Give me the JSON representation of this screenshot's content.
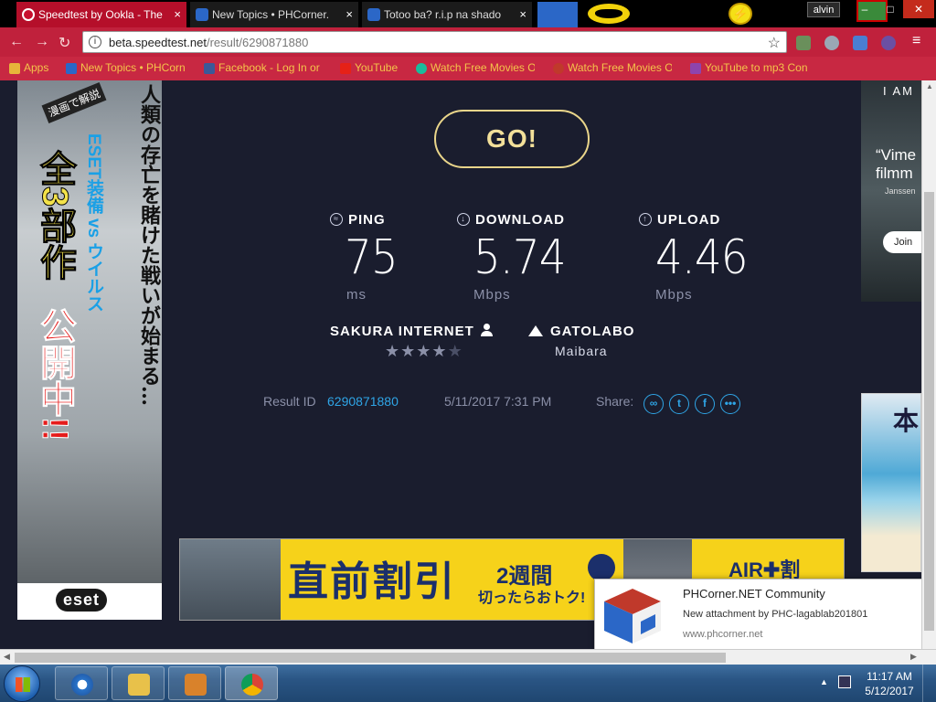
{
  "browser": {
    "tabs": [
      {
        "title": "Speedtest by Ookla - The",
        "active": true
      },
      {
        "title": "New Topics • PHCorner.",
        "active": false
      },
      {
        "title": "Totoo ba? r.i.p na shado",
        "active": false
      }
    ],
    "tab_close": "×",
    "user_name": "alvin",
    "window_buttons": {
      "minimize": "–",
      "maximize": "□",
      "close": "✕"
    },
    "url_host": "beta.speedtest.net",
    "url_path": "/result/6290871880",
    "star_glyph": "☆",
    "info_glyph": "i",
    "nav": {
      "back": "←",
      "forward": "→",
      "reload": "↻"
    },
    "bookmarks": [
      {
        "label": "Apps"
      },
      {
        "label": "New Topics • PHCorn"
      },
      {
        "label": "Facebook - Log In or"
      },
      {
        "label": "YouTube"
      },
      {
        "label": "Watch Free Movies On"
      },
      {
        "label": "Watch Free Movies Or"
      },
      {
        "label": "YouTube to mp3 Con"
      }
    ]
  },
  "speedtest": {
    "go_label": "GO!",
    "ping": {
      "label": "PING",
      "value": "75",
      "unit": "ms"
    },
    "download": {
      "label": "DOWNLOAD",
      "value": "5.74",
      "unit": "Mbps"
    },
    "upload": {
      "label": "UPLOAD",
      "value": "4.46",
      "unit": "Mbps"
    },
    "isp": {
      "name": "SAKURA INTERNET",
      "rating": 4,
      "rating_max": 5
    },
    "server": {
      "name": "GATOLABO",
      "location": "Maibara"
    },
    "result": {
      "label": "Result ID",
      "id": "6290871880",
      "datetime": "5/11/2017 7:31 PM"
    },
    "share_label": "Share:",
    "share_buttons": [
      "link",
      "twitter",
      "facebook",
      "more"
    ]
  },
  "ads": {
    "left": {
      "tag": "漫画で解説",
      "col1": "人類の存亡を賭けた戦いが始まる…",
      "col2": "ESET装備 vs ウイルス",
      "big1": "全3部作",
      "big2": "公開中!!",
      "brand": "eset"
    },
    "right_top": {
      "t1": "I AM",
      "t2": "“Vime filmm",
      "t3": "Janssen",
      "join": "Join"
    },
    "right_bottom": {
      "text": "本"
    },
    "banner": {
      "main": "直前割引",
      "sub1": "2週間",
      "sub2": "切ったらおトク!",
      "brand": "AIR✚割"
    }
  },
  "notification": {
    "title": "PHCorner.NET Community",
    "message": "New attachment by PHC-lagablab201801",
    "site": "www.phcorner.net"
  },
  "taskbar": {
    "time": "11:17 AM",
    "date": "5/12/2017"
  }
}
